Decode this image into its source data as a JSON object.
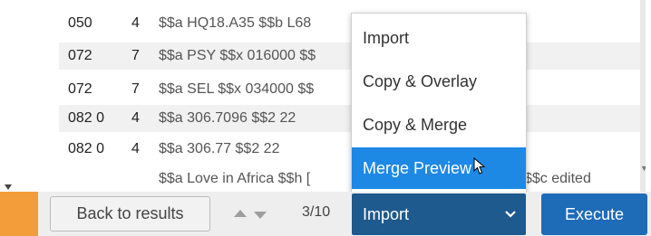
{
  "records": [
    {
      "tag": "050",
      "ind": "4",
      "value": "$$a HQ18.A35 $$b L68"
    },
    {
      "tag": "072",
      "ind": "7",
      "value": "$$a PSY $$x 016000 $$"
    },
    {
      "tag": "072",
      "ind": "7",
      "value": "$$a SEL $$x 034000 $$"
    },
    {
      "tag": "082 0",
      "ind": "4",
      "value": "$$a 306.7096 $$2 22"
    },
    {
      "tag": "082 0",
      "ind": "4",
      "value": "$$a 306.77 $$2 22"
    },
    {
      "tag": "",
      "ind": "",
      "value": "$$a Love in Africa $$h [",
      "value_tail": "$$c edited"
    }
  ],
  "menu": {
    "items": [
      "Import",
      "Copy & Overlay",
      "Copy & Merge",
      "Merge Preview"
    ],
    "selected_index": 3
  },
  "footer": {
    "back_label": "Back to results",
    "pager_text": "3/10",
    "select_value": "Import",
    "execute_label": "Execute"
  },
  "colors": {
    "accent_blue": "#1e88e5",
    "select_bg": "#1e5a8e",
    "execute_bg": "#1e6bb8",
    "orange_strip": "#f39c3a"
  },
  "icons": [
    "chevron-up-icon",
    "chevron-down-icon",
    "select-chevron-icon",
    "mouse-pointer-icon"
  ]
}
